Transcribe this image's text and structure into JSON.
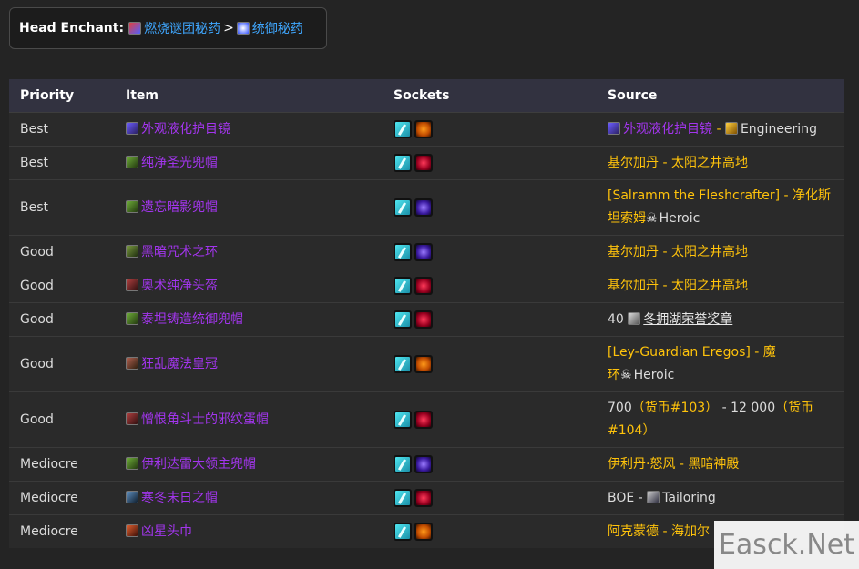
{
  "enchant": {
    "label": "Head Enchant:",
    "enchant_a": "燃烧谜团秘药",
    "separator": ">",
    "enchant_b": "统御秘药"
  },
  "table": {
    "headers": [
      "Priority",
      "Item",
      "Sockets",
      "Source"
    ],
    "rows": [
      {
        "priority": "Best",
        "item": "外观液化护目镜",
        "item_icon": "goggles-icon",
        "sockets": [
          "prism",
          "orange"
        ],
        "source_parts": [
          {
            "text": "外观液化护目镜",
            "style": "item",
            "icon": "goggles-icon"
          },
          {
            "text": " - ",
            "style": "gold"
          },
          {
            "text": "Engineering",
            "style": "white",
            "icon": "engineering-icon"
          }
        ]
      },
      {
        "priority": "Best",
        "item": "纯净圣光兜帽",
        "item_icon": "hood-icon",
        "sockets": [
          "prism",
          "red"
        ],
        "source_parts": [
          {
            "text": "基尔加丹 - 太阳之井高地",
            "style": "gold"
          }
        ]
      },
      {
        "priority": "Best",
        "item": "遗忘暗影兜帽",
        "item_icon": "hood-icon",
        "sockets": [
          "prism",
          "purple"
        ],
        "source_parts": [
          {
            "text": "[Salramm the Fleshcrafter] - 净化斯",
            "style": "gold"
          },
          {
            "text": "坦索姆",
            "style": "gold",
            "break": true
          },
          {
            "text": "Heroic",
            "style": "white",
            "icon": "skull-icon"
          }
        ]
      },
      {
        "priority": "Good",
        "item": "黑暗咒术之环",
        "item_icon": "circlet-icon",
        "sockets": [
          "prism",
          "purple"
        ],
        "source_parts": [
          {
            "text": "基尔加丹 - 太阳之井高地",
            "style": "gold"
          }
        ]
      },
      {
        "priority": "Good",
        "item": "奥术纯净头盔",
        "item_icon": "helm-icon",
        "sockets": [
          "prism",
          "red"
        ],
        "source_parts": [
          {
            "text": "基尔加丹 - 太阳之井高地",
            "style": "gold"
          }
        ]
      },
      {
        "priority": "Good",
        "item": "泰坦铸造统御兜帽",
        "item_icon": "hood-icon",
        "sockets": [
          "prism",
          "red"
        ],
        "source_parts": [
          {
            "text": "40",
            "style": "white"
          },
          {
            "text": "冬拥湖荣誉奖章",
            "style": "underline",
            "icon": "medal-icon"
          }
        ]
      },
      {
        "priority": "Good",
        "item": "狂乱魔法皇冠",
        "item_icon": "crown-icon",
        "sockets": [
          "prism",
          "orange"
        ],
        "source_parts": [
          {
            "text": "[Ley-Guardian Eregos] - 魔",
            "style": "gold"
          },
          {
            "text": "环",
            "style": "gold",
            "break": true
          },
          {
            "text": "Heroic",
            "style": "white",
            "icon": "skull-icon"
          }
        ]
      },
      {
        "priority": "Good",
        "item": "憎恨角斗士的邪纹蛋帽",
        "item_icon": "helm-icon",
        "sockets": [
          "prism",
          "red"
        ],
        "source_parts": [
          {
            "text": "700",
            "style": "white"
          },
          {
            "text": "（货币#103）",
            "style": "gold"
          },
          {
            "text": " - 12 000",
            "style": "white"
          },
          {
            "text": "（货币",
            "style": "gold"
          },
          {
            "text": "#104）",
            "style": "gold",
            "break": true
          }
        ]
      },
      {
        "priority": "Mediocre",
        "item": "伊利达雷大领主兜帽",
        "item_icon": "hood-icon",
        "sockets": [
          "prism",
          "purple"
        ],
        "source_parts": [
          {
            "text": "伊利丹·怒风 - 黑暗神殿",
            "style": "gold"
          }
        ]
      },
      {
        "priority": "Mediocre",
        "item": "寒冬末日之帽",
        "item_icon": "hat-icon",
        "sockets": [
          "prism",
          "red"
        ],
        "source_parts": [
          {
            "text": "BOE - ",
            "style": "white"
          },
          {
            "text": "Tailoring",
            "style": "white",
            "icon": "tailoring-icon"
          }
        ]
      },
      {
        "priority": "Mediocre",
        "item": "凶星头巾",
        "item_icon": "turban-icon",
        "sockets": [
          "prism",
          "orange"
        ],
        "source_parts": [
          {
            "text": "阿克蒙德 - 海加尔",
            "style": "gold"
          }
        ]
      }
    ]
  },
  "colors": {
    "background": "#242424",
    "item_epic": "#a335ee",
    "source_gold": "#ffc30b",
    "enchant_link": "#3fa7ff",
    "header_bg": "#323240"
  },
  "watermark": "Easck.Net"
}
